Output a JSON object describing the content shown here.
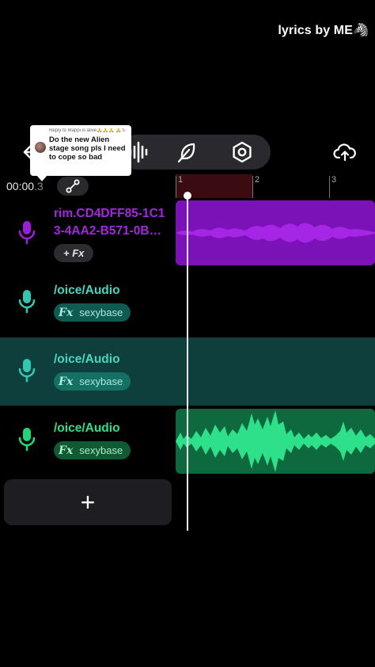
{
  "overlay": {
    "caption": "lyrics by ME🦓"
  },
  "reply_bubble": {
    "meta": "Reply to Mappi is alive🙏🙏🙏 🙏's comment",
    "text": "Do the new Alien stage song pls I need to cope so bad"
  },
  "toolbar": {
    "tools": [
      "back-icon",
      "waveform-icon",
      "feather-icon",
      "settings-icon",
      "upload-icon"
    ]
  },
  "transport": {
    "time_main": "00:00",
    "time_frac": ".3"
  },
  "ruler": {
    "marks": [
      "1",
      "2",
      "3"
    ]
  },
  "tracks": [
    {
      "name_line1": "rim.CD4DFF85-1C1",
      "name_line2": "3-4AA2-B571-0B…",
      "fx_label": "+ Fx",
      "effect": "",
      "color": "#9b1fd6"
    },
    {
      "name_line1": "/oice/Audio",
      "fx_label": "Fx",
      "effect": "sexybase",
      "color": "#33c6b0"
    },
    {
      "name_line1": "/oice/Audio",
      "fx_label": "Fx",
      "effect": "sexybase",
      "color": "#33c6b0"
    },
    {
      "name_line1": "/oice/Audio",
      "fx_label": "Fx",
      "effect": "sexybase",
      "color": "#1fd67a"
    }
  ],
  "add_track": {
    "label": "+"
  }
}
